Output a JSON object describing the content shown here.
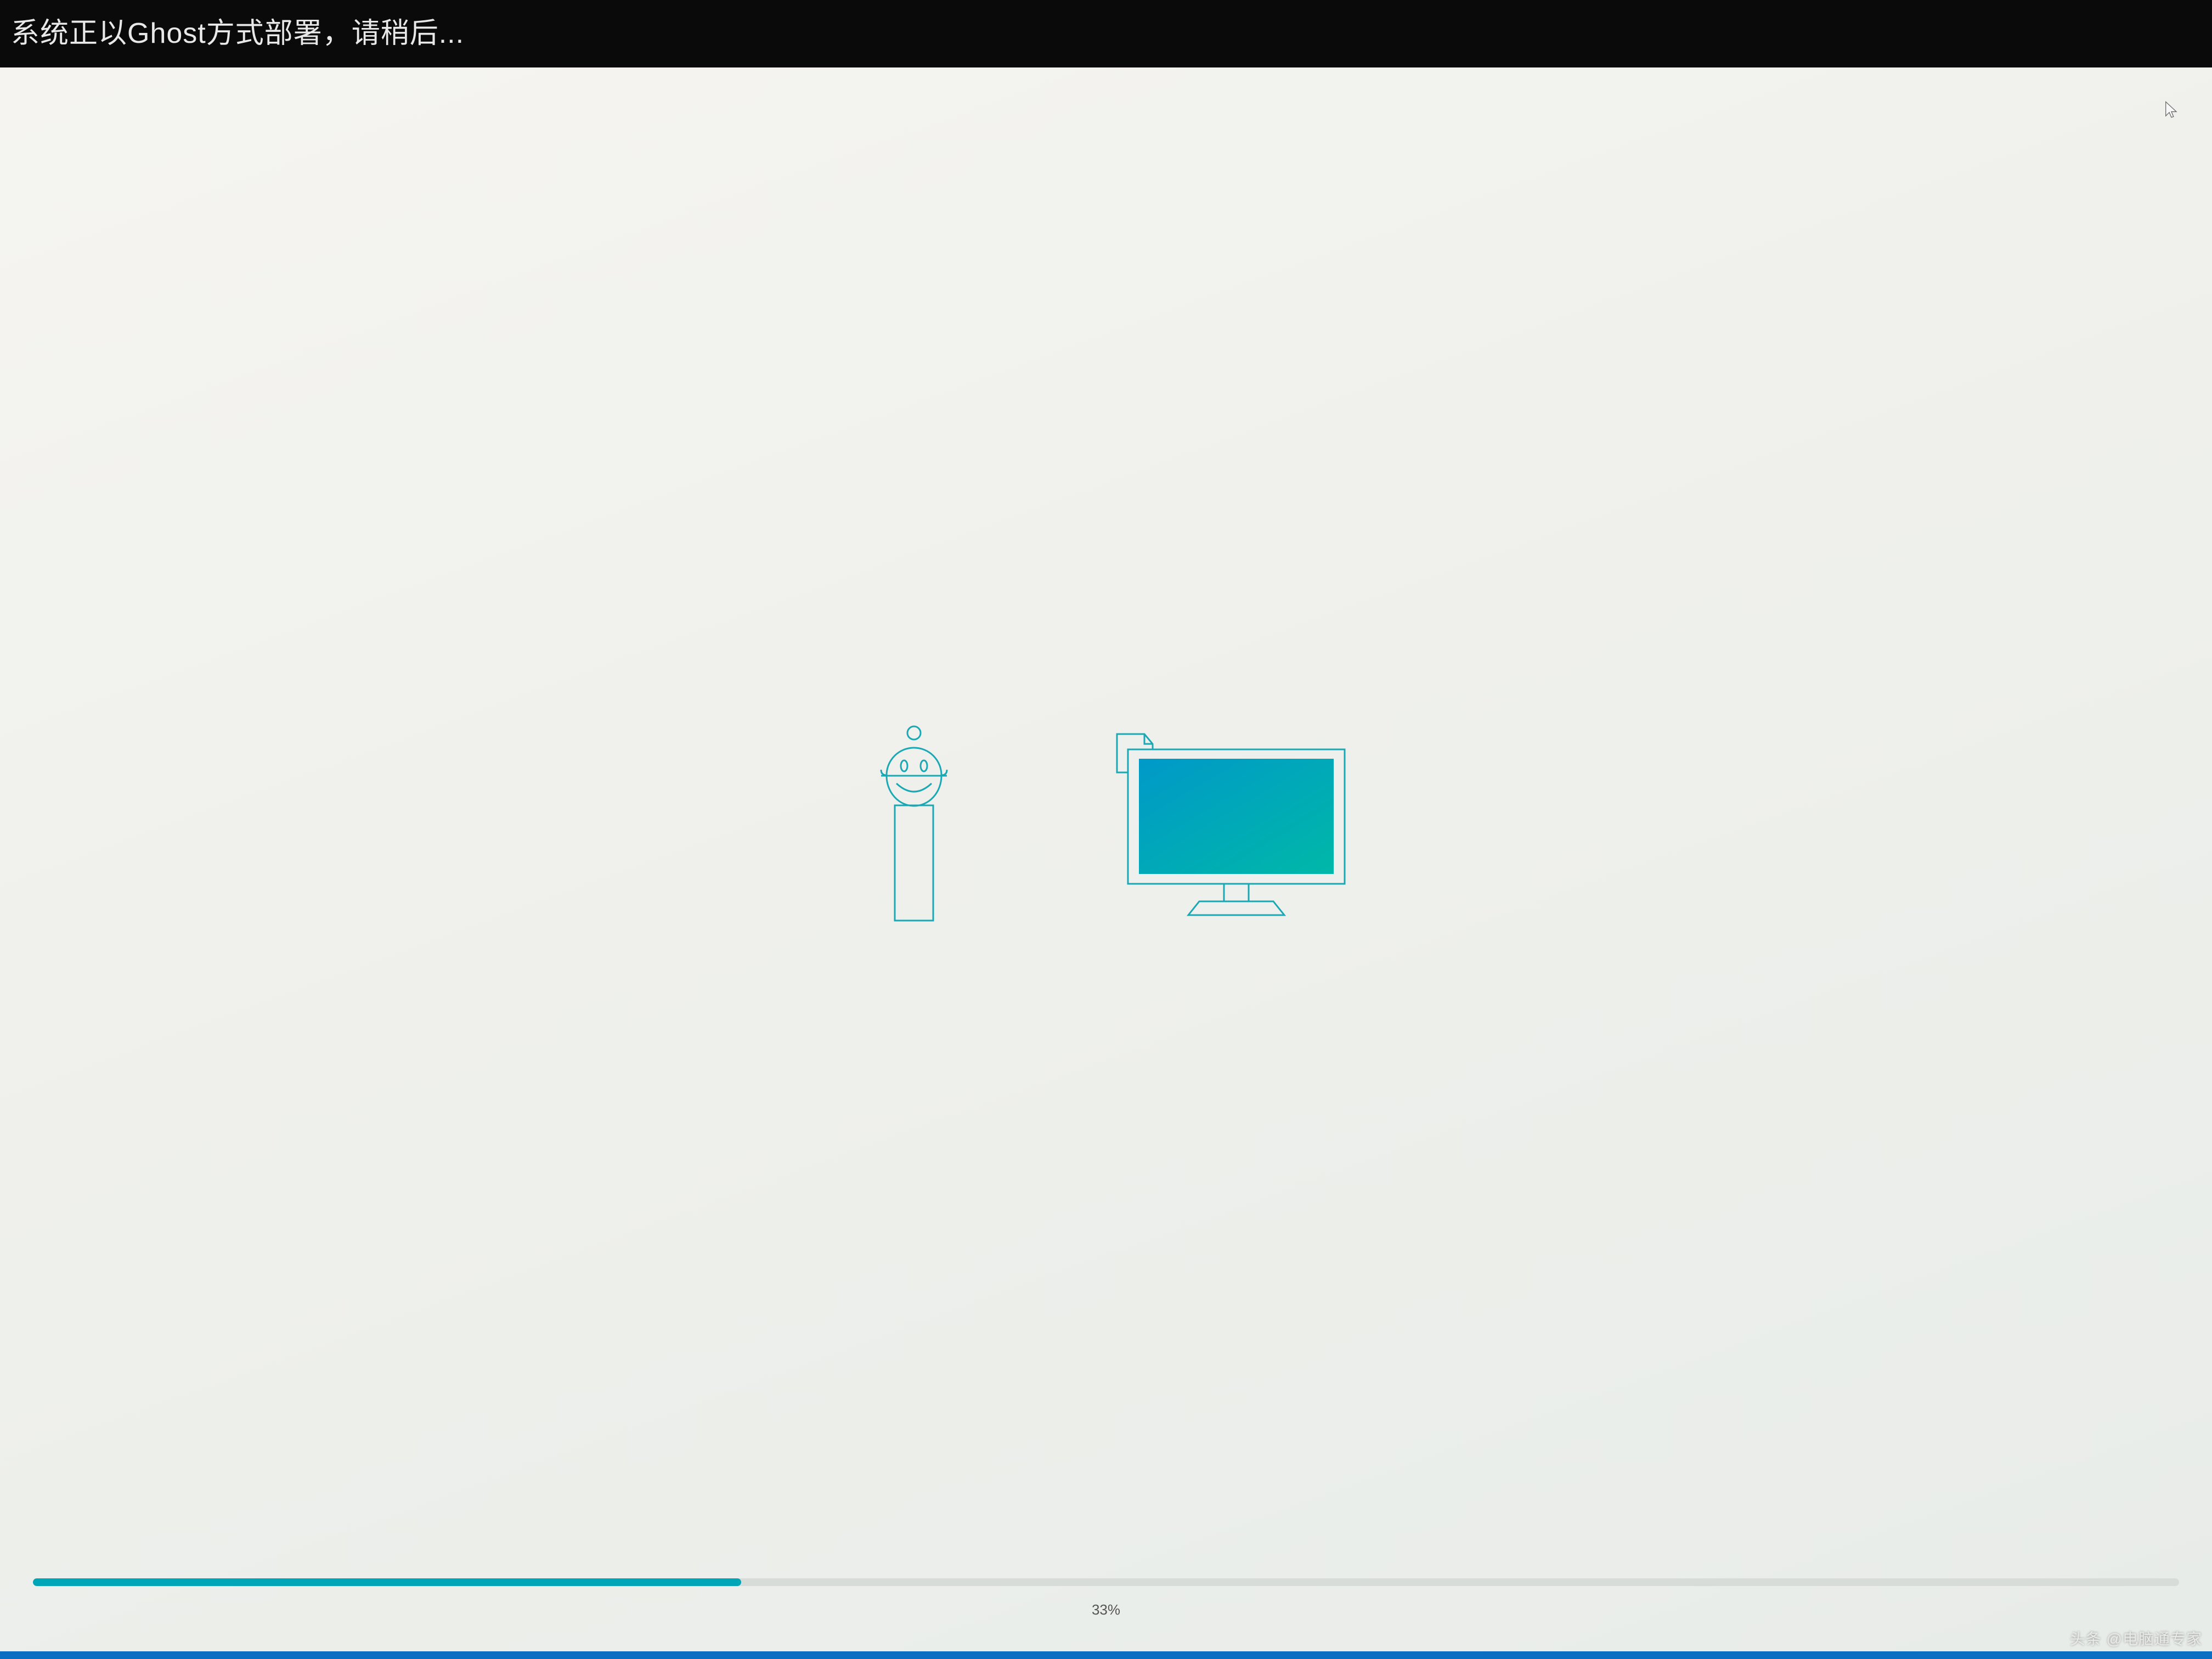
{
  "header": {
    "title": "系统正以Ghost方式部署，请稍后..."
  },
  "progress": {
    "percent": 33,
    "label": "33%"
  },
  "icons": {
    "robot": "robot-mascot-icon",
    "monitor": "monitor-icon",
    "file": "file-icon",
    "cursor": "cursor-icon"
  },
  "colors": {
    "accent": "#00a6b8",
    "header_bg": "#0a0a0a",
    "screen_gradient_start": "#0099c8",
    "screen_gradient_end": "#00b8a8"
  },
  "watermark": {
    "text": "头条 @电脑通专家"
  }
}
